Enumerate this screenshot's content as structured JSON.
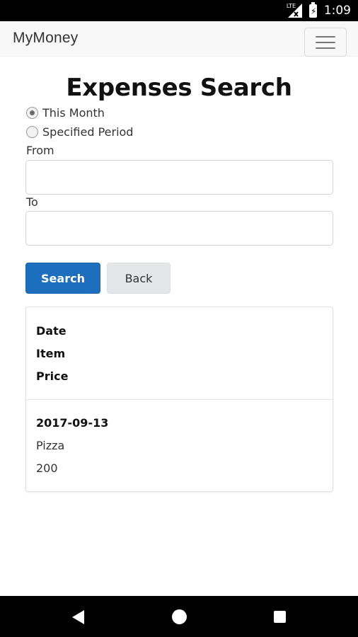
{
  "status_bar": {
    "network": "LTE",
    "time": "1:09"
  },
  "navbar": {
    "brand": "MyMoney"
  },
  "page": {
    "title": "Expenses Search"
  },
  "form": {
    "period_options": [
      {
        "label": "This Month",
        "checked": true
      },
      {
        "label": "Specified Period",
        "checked": false
      }
    ],
    "from_label": "From",
    "from_value": "",
    "to_label": "To",
    "to_value": ""
  },
  "buttons": {
    "search": "Search",
    "back": "Back"
  },
  "results": {
    "headers": [
      "Date",
      "Item",
      "Price"
    ],
    "rows": [
      {
        "date": "2017-09-13",
        "item": "Pizza",
        "price": "200"
      }
    ]
  }
}
